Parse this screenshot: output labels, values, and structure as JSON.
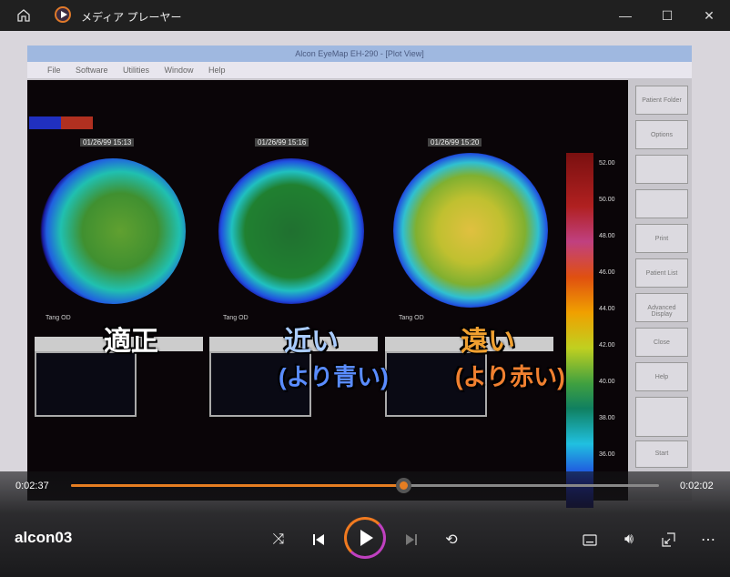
{
  "titlebar": {
    "app_title": "メディア プレーヤー",
    "minimize": "—",
    "maximize": "☐",
    "close": "✕"
  },
  "video": {
    "window_title": "Alcon EyeMap EH-290 - [Plot View]",
    "menu": "File Software Utilities Window Help",
    "dates": [
      "01/26/99 15:13",
      "01/26/99 15:16",
      "01/26/99 15:20"
    ],
    "tang_label": "Tang  OD",
    "subtitles": {
      "left": "適正",
      "middle": "近い",
      "middle_sub": "(より青い)",
      "right": "遠い",
      "right_sub": "(より赤い)"
    },
    "scale_values": [
      "52.00",
      "50.00",
      "48.00",
      "46.00",
      "44.00",
      "42.00",
      "40.00",
      "38.00",
      "36.00"
    ],
    "side_buttons": [
      "Patient Folder",
      "Options",
      "",
      "",
      "Print",
      "Patient List",
      "Advanced Display",
      "Close",
      "Help",
      "",
      "Start"
    ]
  },
  "player": {
    "elapsed": "0:02:37",
    "remaining": "0:02:02",
    "progress_percent": 56.5,
    "media_title": "alcon03",
    "colors": {
      "accent": "#e67e22"
    }
  }
}
